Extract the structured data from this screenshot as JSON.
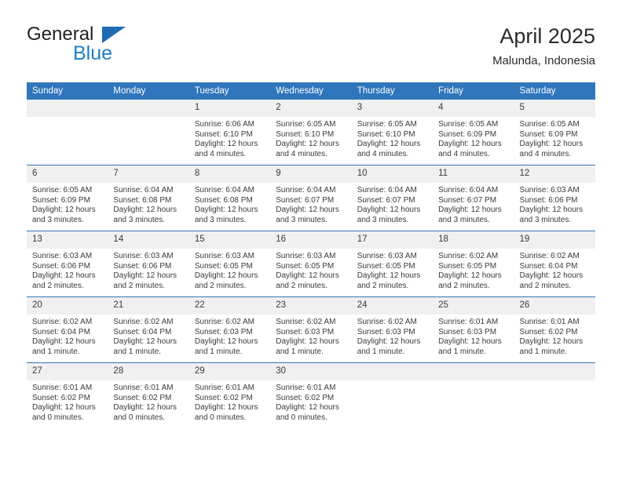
{
  "brand": {
    "word_one": "General",
    "word_two": "Blue",
    "triangle_color": "#1f6cb4",
    "blue_color": "#1f7ec4"
  },
  "header": {
    "title": "April 2025",
    "subtitle": "Malunda, Indonesia",
    "accent_color": "#2f76bc",
    "band_color": "#f0f0f0"
  },
  "weekdays": [
    "Sunday",
    "Monday",
    "Tuesday",
    "Wednesday",
    "Thursday",
    "Friday",
    "Saturday"
  ],
  "labels": {
    "sunrise_prefix": "Sunrise: ",
    "sunset_prefix": "Sunset: ",
    "daylight_prefix": "Daylight: "
  },
  "weeks": [
    [
      {
        "day": "",
        "empty": true
      },
      {
        "day": "",
        "empty": true
      },
      {
        "day": "1",
        "sunrise": "Sunrise: 6:06 AM",
        "sunset": "Sunset: 6:10 PM",
        "daylight_line1": "Daylight: 12 hours",
        "daylight_line2": "and 4 minutes."
      },
      {
        "day": "2",
        "sunrise": "Sunrise: 6:05 AM",
        "sunset": "Sunset: 6:10 PM",
        "daylight_line1": "Daylight: 12 hours",
        "daylight_line2": "and 4 minutes."
      },
      {
        "day": "3",
        "sunrise": "Sunrise: 6:05 AM",
        "sunset": "Sunset: 6:10 PM",
        "daylight_line1": "Daylight: 12 hours",
        "daylight_line2": "and 4 minutes."
      },
      {
        "day": "4",
        "sunrise": "Sunrise: 6:05 AM",
        "sunset": "Sunset: 6:09 PM",
        "daylight_line1": "Daylight: 12 hours",
        "daylight_line2": "and 4 minutes."
      },
      {
        "day": "5",
        "sunrise": "Sunrise: 6:05 AM",
        "sunset": "Sunset: 6:09 PM",
        "daylight_line1": "Daylight: 12 hours",
        "daylight_line2": "and 4 minutes."
      }
    ],
    [
      {
        "day": "6",
        "sunrise": "Sunrise: 6:05 AM",
        "sunset": "Sunset: 6:09 PM",
        "daylight_line1": "Daylight: 12 hours",
        "daylight_line2": "and 3 minutes."
      },
      {
        "day": "7",
        "sunrise": "Sunrise: 6:04 AM",
        "sunset": "Sunset: 6:08 PM",
        "daylight_line1": "Daylight: 12 hours",
        "daylight_line2": "and 3 minutes."
      },
      {
        "day": "8",
        "sunrise": "Sunrise: 6:04 AM",
        "sunset": "Sunset: 6:08 PM",
        "daylight_line1": "Daylight: 12 hours",
        "daylight_line2": "and 3 minutes."
      },
      {
        "day": "9",
        "sunrise": "Sunrise: 6:04 AM",
        "sunset": "Sunset: 6:07 PM",
        "daylight_line1": "Daylight: 12 hours",
        "daylight_line2": "and 3 minutes."
      },
      {
        "day": "10",
        "sunrise": "Sunrise: 6:04 AM",
        "sunset": "Sunset: 6:07 PM",
        "daylight_line1": "Daylight: 12 hours",
        "daylight_line2": "and 3 minutes."
      },
      {
        "day": "11",
        "sunrise": "Sunrise: 6:04 AM",
        "sunset": "Sunset: 6:07 PM",
        "daylight_line1": "Daylight: 12 hours",
        "daylight_line2": "and 3 minutes."
      },
      {
        "day": "12",
        "sunrise": "Sunrise: 6:03 AM",
        "sunset": "Sunset: 6:06 PM",
        "daylight_line1": "Daylight: 12 hours",
        "daylight_line2": "and 3 minutes."
      }
    ],
    [
      {
        "day": "13",
        "sunrise": "Sunrise: 6:03 AM",
        "sunset": "Sunset: 6:06 PM",
        "daylight_line1": "Daylight: 12 hours",
        "daylight_line2": "and 2 minutes."
      },
      {
        "day": "14",
        "sunrise": "Sunrise: 6:03 AM",
        "sunset": "Sunset: 6:06 PM",
        "daylight_line1": "Daylight: 12 hours",
        "daylight_line2": "and 2 minutes."
      },
      {
        "day": "15",
        "sunrise": "Sunrise: 6:03 AM",
        "sunset": "Sunset: 6:05 PM",
        "daylight_line1": "Daylight: 12 hours",
        "daylight_line2": "and 2 minutes."
      },
      {
        "day": "16",
        "sunrise": "Sunrise: 6:03 AM",
        "sunset": "Sunset: 6:05 PM",
        "daylight_line1": "Daylight: 12 hours",
        "daylight_line2": "and 2 minutes."
      },
      {
        "day": "17",
        "sunrise": "Sunrise: 6:03 AM",
        "sunset": "Sunset: 6:05 PM",
        "daylight_line1": "Daylight: 12 hours",
        "daylight_line2": "and 2 minutes."
      },
      {
        "day": "18",
        "sunrise": "Sunrise: 6:02 AM",
        "sunset": "Sunset: 6:05 PM",
        "daylight_line1": "Daylight: 12 hours",
        "daylight_line2": "and 2 minutes."
      },
      {
        "day": "19",
        "sunrise": "Sunrise: 6:02 AM",
        "sunset": "Sunset: 6:04 PM",
        "daylight_line1": "Daylight: 12 hours",
        "daylight_line2": "and 2 minutes."
      }
    ],
    [
      {
        "day": "20",
        "sunrise": "Sunrise: 6:02 AM",
        "sunset": "Sunset: 6:04 PM",
        "daylight_line1": "Daylight: 12 hours",
        "daylight_line2": "and 1 minute."
      },
      {
        "day": "21",
        "sunrise": "Sunrise: 6:02 AM",
        "sunset": "Sunset: 6:04 PM",
        "daylight_line1": "Daylight: 12 hours",
        "daylight_line2": "and 1 minute."
      },
      {
        "day": "22",
        "sunrise": "Sunrise: 6:02 AM",
        "sunset": "Sunset: 6:03 PM",
        "daylight_line1": "Daylight: 12 hours",
        "daylight_line2": "and 1 minute."
      },
      {
        "day": "23",
        "sunrise": "Sunrise: 6:02 AM",
        "sunset": "Sunset: 6:03 PM",
        "daylight_line1": "Daylight: 12 hours",
        "daylight_line2": "and 1 minute."
      },
      {
        "day": "24",
        "sunrise": "Sunrise: 6:02 AM",
        "sunset": "Sunset: 6:03 PM",
        "daylight_line1": "Daylight: 12 hours",
        "daylight_line2": "and 1 minute."
      },
      {
        "day": "25",
        "sunrise": "Sunrise: 6:01 AM",
        "sunset": "Sunset: 6:03 PM",
        "daylight_line1": "Daylight: 12 hours",
        "daylight_line2": "and 1 minute."
      },
      {
        "day": "26",
        "sunrise": "Sunrise: 6:01 AM",
        "sunset": "Sunset: 6:02 PM",
        "daylight_line1": "Daylight: 12 hours",
        "daylight_line2": "and 1 minute."
      }
    ],
    [
      {
        "day": "27",
        "sunrise": "Sunrise: 6:01 AM",
        "sunset": "Sunset: 6:02 PM",
        "daylight_line1": "Daylight: 12 hours",
        "daylight_line2": "and 0 minutes."
      },
      {
        "day": "28",
        "sunrise": "Sunrise: 6:01 AM",
        "sunset": "Sunset: 6:02 PM",
        "daylight_line1": "Daylight: 12 hours",
        "daylight_line2": "and 0 minutes."
      },
      {
        "day": "29",
        "sunrise": "Sunrise: 6:01 AM",
        "sunset": "Sunset: 6:02 PM",
        "daylight_line1": "Daylight: 12 hours",
        "daylight_line2": "and 0 minutes."
      },
      {
        "day": "30",
        "sunrise": "Sunrise: 6:01 AM",
        "sunset": "Sunset: 6:02 PM",
        "daylight_line1": "Daylight: 12 hours",
        "daylight_line2": "and 0 minutes."
      },
      {
        "day": "",
        "empty": true
      },
      {
        "day": "",
        "empty": true
      },
      {
        "day": "",
        "empty": true
      }
    ]
  ]
}
